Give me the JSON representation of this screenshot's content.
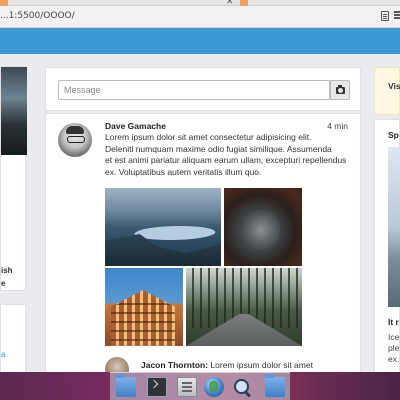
{
  "browser": {
    "url": "...1:5500/OOOO/"
  },
  "left_sidebar": {
    "partial_text_1": "ish",
    "partial_text_2": "e",
    "partial_link": "a"
  },
  "composer": {
    "placeholder": "Message"
  },
  "post": {
    "author": "Dave Gamache",
    "time": "4 min",
    "body_line_1": "Lorem ipsum dolor sit amet consectetur adipisicing elit.",
    "body_line_2": "Deleniti numquam maxime odio fugiat similique. Assumenda",
    "body_line_3": "et est animi pariatur aliquam earum ullam, excepturi repellendus",
    "body_line_4": "ex. Voluptatibus autem veritatis illum quo.",
    "photos": [
      "fjord-photo",
      "cave-photo",
      "building-photo",
      "forest-road-photo"
    ]
  },
  "reply": {
    "author": "Jacon Thornton:",
    "text": "Lorem ipsum dolor sit amet"
  },
  "right_sidebar": {
    "card1_text": "Vis",
    "card2_title": "Sp",
    "card2_subtitle": "It r",
    "line_1": "Ice",
    "line_2": "ple",
    "line_3": "ex."
  },
  "dock": {
    "items": [
      "folder-icon",
      "terminal-icon",
      "files-icon",
      "globe-icon",
      "search-icon",
      "folder-icon"
    ]
  }
}
